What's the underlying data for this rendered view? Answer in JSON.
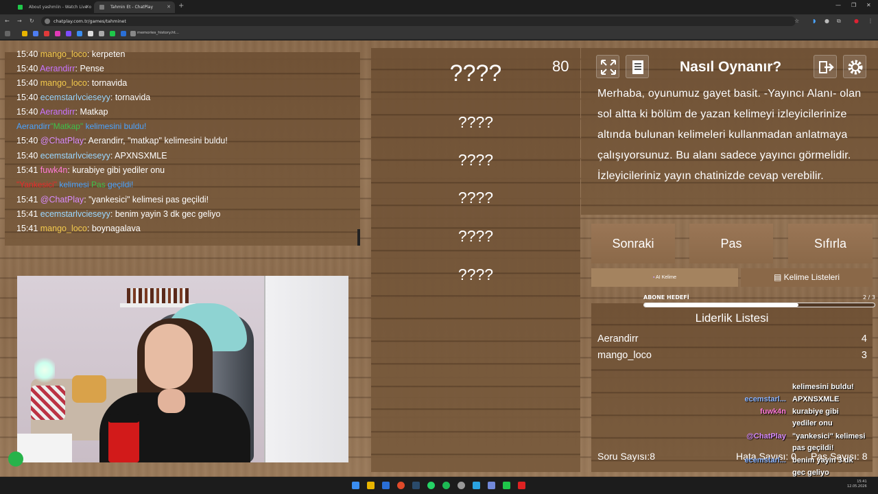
{
  "browser": {
    "tabs": [
      {
        "title": "About yashmiin - Watch Live o"
      },
      {
        "title": "Tahmin Et - ChatPlay"
      }
    ],
    "url": "chatplay.com.tr/games/tahminet",
    "bookmark_text": "memories_history.ht..."
  },
  "chat": {
    "messages": [
      {
        "time": "15:40",
        "user": "mango_loco",
        "user_color": "#f2c94c",
        "text": ": kerpeten"
      },
      {
        "time": "15:40",
        "user": "Aerandirr",
        "user_color": "#c873ff",
        "text": ": Pense"
      },
      {
        "time": "15:40",
        "user": "mango_loco",
        "user_color": "#f2c94c",
        "text": ": tornavida"
      },
      {
        "time": "15:40",
        "user": "ecemstarlvcieseyy",
        "user_color": "#9ad7ff",
        "text": ": tornavida"
      },
      {
        "time": "15:40",
        "user": "Aerandirr",
        "user_color": "#c873ff",
        "text": ": Matkap"
      },
      {
        "system_found": {
          "user": "Aerandirr",
          "word": "\"Matkap\"",
          "rest": " kelimesini buldu!"
        }
      },
      {
        "time": "15:40",
        "user": "@ChatPlay",
        "user_color": "#d98cff",
        "text": ": Aerandirr, \"matkap\" kelimesini buldu!"
      },
      {
        "time": "15:40",
        "user": "ecemstarlvcieseyy",
        "user_color": "#9ad7ff",
        "text": ": APXNSXMLE"
      },
      {
        "time": "15:41",
        "user": "fuwk4n",
        "user_color": "#ff7ad9",
        "text": ": kurabiye gibi yediler onu"
      },
      {
        "system_pass": {
          "word": "\"Yankesici\"",
          "mid": " kelimesi ",
          "pas": "Pas",
          "rest": " geçildi!"
        }
      },
      {
        "time": "15:41",
        "user": "@ChatPlay",
        "user_color": "#d98cff",
        "text": ": \"yankesici\" kelimesi pas geçildi!"
      },
      {
        "time": "15:41",
        "user": "ecemstarlvcieseyy",
        "user_color": "#9ad7ff",
        "text": ": benim yayin 3 dk gec geliyo"
      },
      {
        "time": "15:41",
        "user": "mango_loco",
        "user_color": "#f2c94c",
        "text": ": boynagalava"
      }
    ]
  },
  "words": {
    "timer": "80",
    "main": "????",
    "banned": [
      "????",
      "????",
      "????",
      "????",
      "????"
    ]
  },
  "info": {
    "title": "Nasıl Oynanır?",
    "description": "Merhaba, oyunumuz gayet basit. -Yayıncı Alanı- olan sol altta ki bölüm de yazan kelimeyi izleyicilerinize altında bulunan kelimeleri kullanmadan anlatmaya çalışıyorsunuz. Bu alanı sadece yayıncı görmelidir. İzleyicileriniz yayın chatinizde cevap verebilir."
  },
  "actions": {
    "next": "Sonraki",
    "pass": "Pas",
    "reset": "Sıfırla"
  },
  "tabs": {
    "ai": "AI Kelime",
    "lists": "Kelime Listeleri"
  },
  "subscriber_goal": {
    "label": "ABONE HEDEFİ",
    "count": "2 / 3",
    "progress": 0.67
  },
  "leaderboard": {
    "title": "Liderlik Listesi",
    "entries": [
      {
        "name": "Aerandirr",
        "score": "4"
      },
      {
        "name": "mango_loco",
        "score": "3"
      }
    ],
    "question_count": "Soru Sayısı:8",
    "error_count": "Hata Sayısı: 0",
    "pass_count": "Pas Sayısı: 8"
  },
  "overlay_chat": [
    {
      "user": "",
      "msg": "kelimesini buldu!",
      "color": "#ffffff"
    },
    {
      "user": "ecemstarl...",
      "msg": "APXNSXMLE",
      "color": "#8ab4ff"
    },
    {
      "user": "fuwk4n",
      "msg": "kurabiye gibi",
      "color": "#ff7ad9"
    },
    {
      "user": "",
      "msg": "yediler onu",
      "color": "#ffffff"
    },
    {
      "user": "@ChatPlay",
      "msg": "\"yankesici\" kelimesi",
      "color": "#d98cff"
    },
    {
      "user": "",
      "msg": "pas geçildi!",
      "color": "#ffffff"
    },
    {
      "user": "ecemstarl...",
      "msg": "benim yayin 3 dk",
      "color": "#8ab4ff"
    },
    {
      "user": "",
      "msg": "gec geliyo",
      "color": "#ffffff"
    },
    {
      "user": "mango_loco",
      "msg": "boynagalava",
      "color": "#f2c94c"
    }
  ],
  "taskbar": {
    "time": "15:41",
    "date": "12.05.2026"
  }
}
